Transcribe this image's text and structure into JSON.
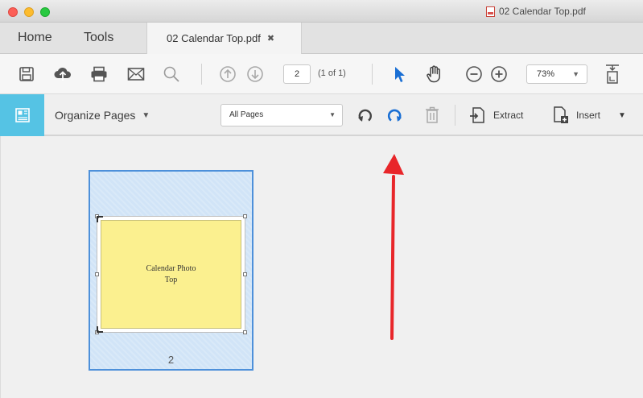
{
  "window": {
    "title": "02 Calendar Top.pdf"
  },
  "tabs": {
    "home": "Home",
    "tools": "Tools",
    "document": "02 Calendar Top.pdf",
    "close_glyph": "✖"
  },
  "toolbar": {
    "page_value": "2",
    "page_of": "(1 of 1)",
    "zoom": "73%"
  },
  "organize": {
    "title": "Organize Pages",
    "pages_filter": "All Pages",
    "extract_label": "Extract",
    "insert_label": "Insert"
  },
  "thumbnail": {
    "caption_line1": "Calendar Photo",
    "caption_line2": "Top",
    "page_number": "2"
  },
  "colors": {
    "accent_blue": "#4d90da",
    "organize_side": "#55c3e4",
    "annotation_red": "#e8262a",
    "page_yellow": "#fbf08f"
  },
  "icons": [
    "save-icon",
    "upload-icon",
    "print-icon",
    "email-icon",
    "search-icon",
    "prev-page-icon",
    "next-page-icon",
    "select-cursor-icon",
    "hand-icon",
    "zoom-out-icon",
    "zoom-in-icon",
    "fit-page-icon",
    "organize-pages-icon",
    "rotate-left-icon",
    "rotate-right-icon",
    "delete-icon",
    "extract-icon",
    "insert-icon"
  ]
}
